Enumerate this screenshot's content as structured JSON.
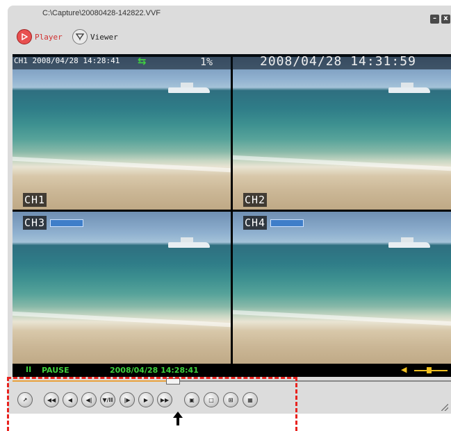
{
  "window": {
    "title": "C:\\Capture\\20080428-142822.VVF",
    "minimize_label": "–",
    "close_label": "x"
  },
  "modes": {
    "player_label": "Player",
    "viewer_label": "Viewer"
  },
  "overlay": {
    "channel_time": "CH1 2008/04/28 14:28:41",
    "percent": "1%",
    "clock": "2008/04/28 14:31:59"
  },
  "channels": [
    {
      "label": "CH1"
    },
    {
      "label": "CH2"
    },
    {
      "label": "CH3"
    },
    {
      "label": "CH4"
    }
  ],
  "status": {
    "state": "PAUSE",
    "timestamp": "2008/04/28 14:28:41"
  },
  "seek": {
    "position_fraction": 0.35
  },
  "volume": {
    "level_fraction": 0.4
  },
  "controls": [
    {
      "name": "open-file-button",
      "glyph": "↗"
    },
    {
      "name": "fast-rewind-button",
      "glyph": "◀◀"
    },
    {
      "name": "step-back-button",
      "glyph": "◀"
    },
    {
      "name": "slow-rewind-button",
      "glyph": "◀|"
    },
    {
      "name": "play-pause-button",
      "glyph": "▼/II"
    },
    {
      "name": "slow-forward-button",
      "glyph": "|▶"
    },
    {
      "name": "play-button",
      "glyph": "▶"
    },
    {
      "name": "fast-forward-button",
      "glyph": "▶▶"
    },
    {
      "name": "snapshot-button",
      "glyph": "▣"
    },
    {
      "name": "single-view-button",
      "glyph": "□"
    },
    {
      "name": "quad-view-button",
      "glyph": "⊞"
    },
    {
      "name": "nine-view-button",
      "glyph": "▦"
    }
  ],
  "colors": {
    "status_green": "#3ed13e",
    "annotation_red": "#e8231f",
    "seek_orange": "#e9a03a"
  }
}
